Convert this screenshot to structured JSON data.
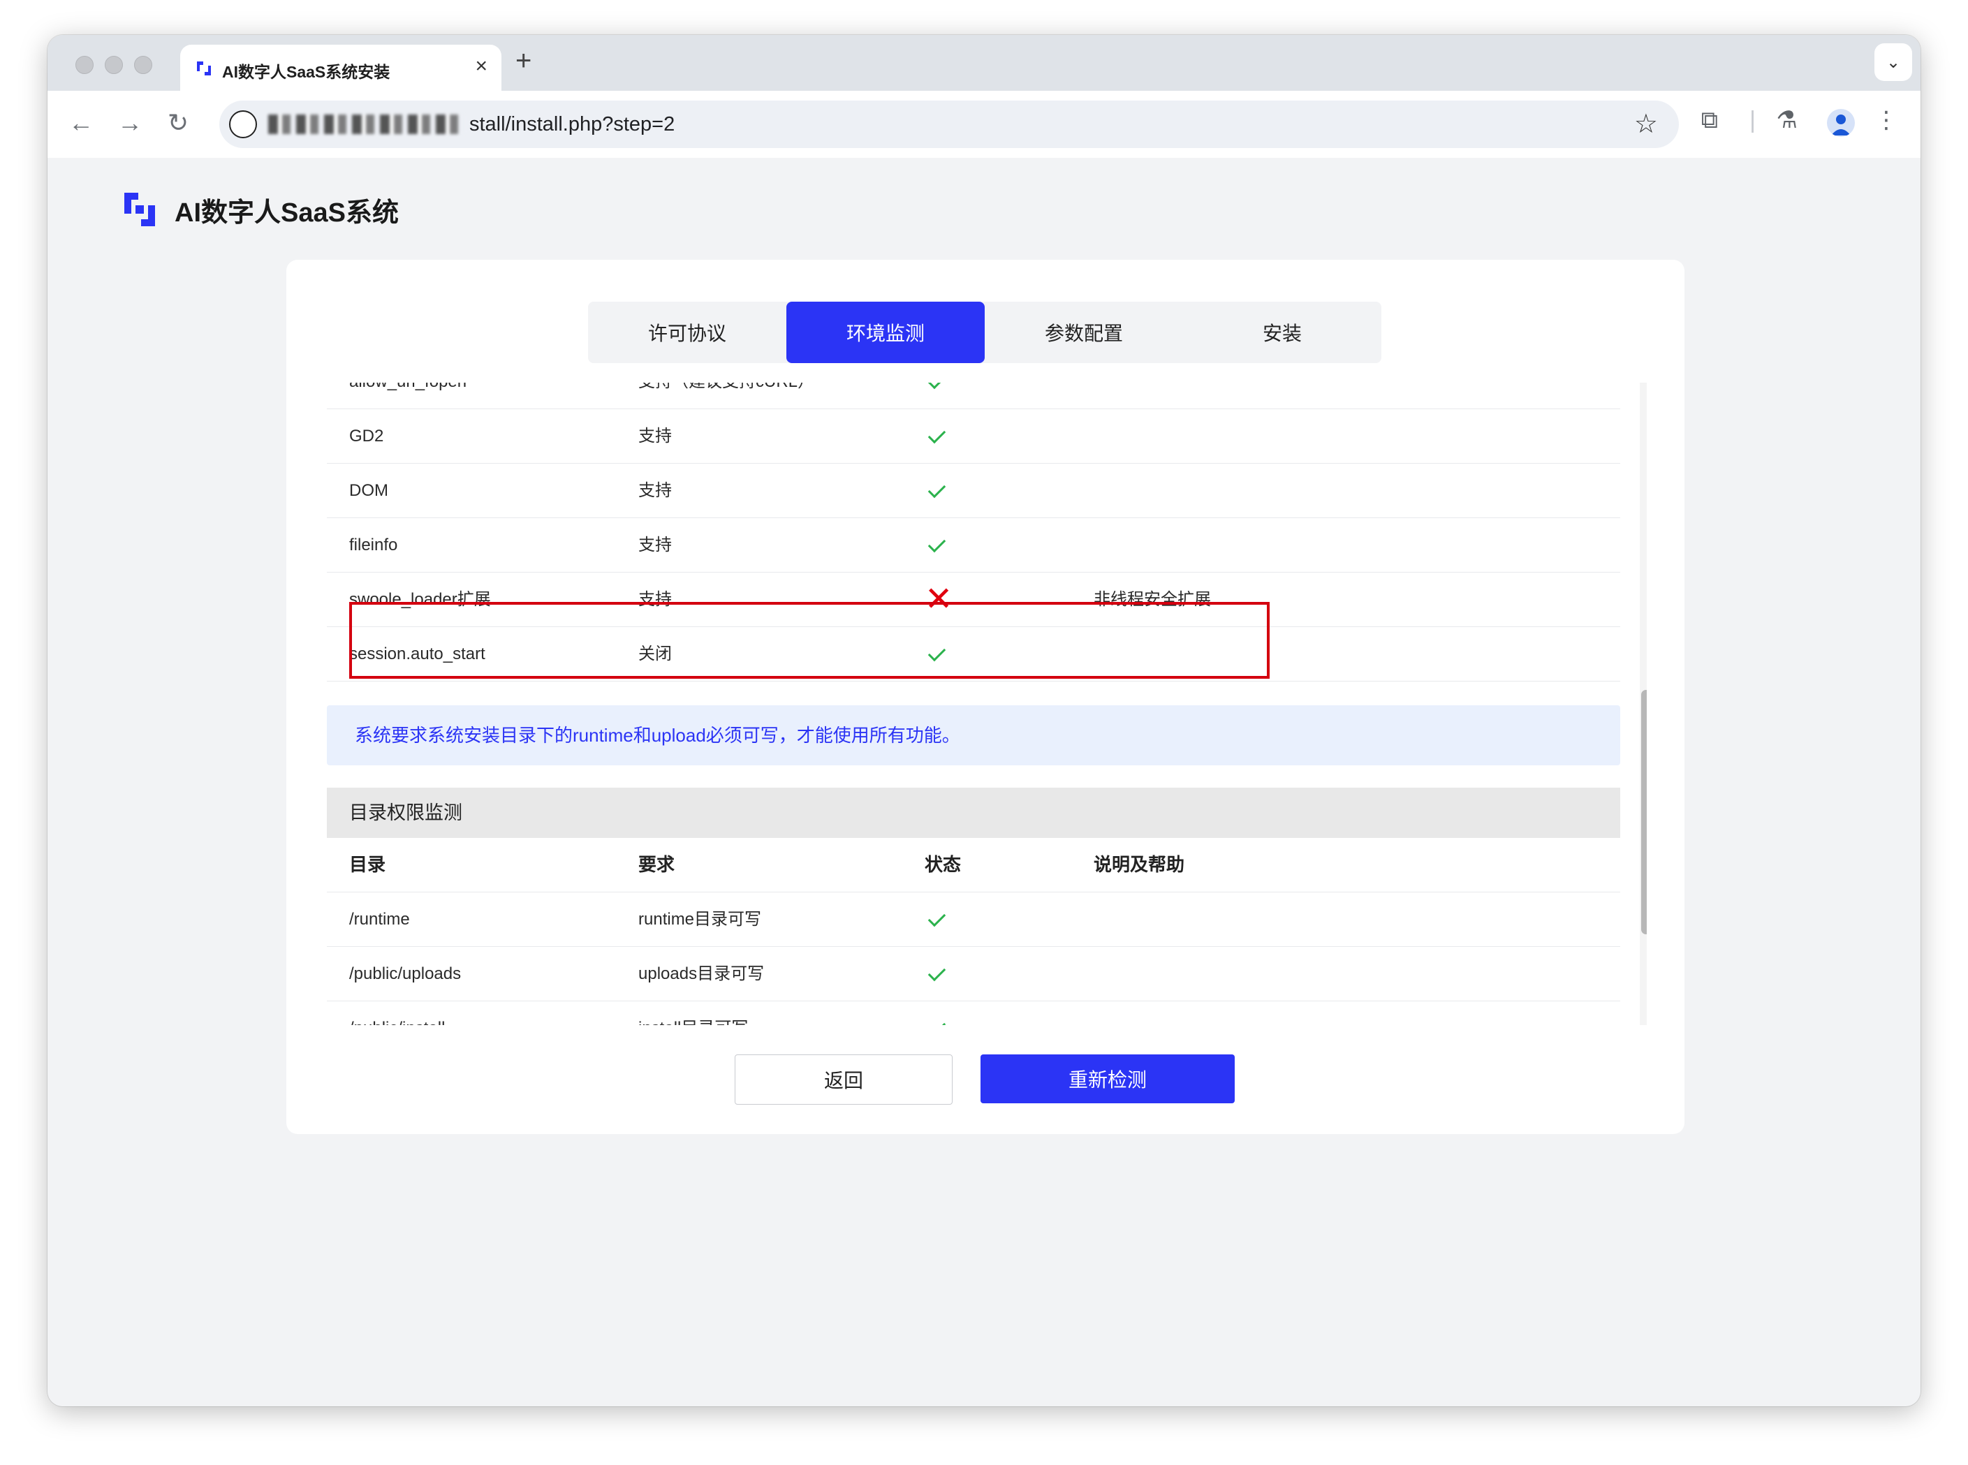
{
  "browser": {
    "tab_title": "AI数字人SaaS系统安装",
    "tab_close": "×",
    "new_tab": "+",
    "url_visible": "stall/install.php?step=2"
  },
  "brand": {
    "name": "AI数字人SaaS系统",
    "accent_color": "#2b34f5"
  },
  "steps": [
    {
      "label": "许可协议",
      "active": false
    },
    {
      "label": "环境监测",
      "active": true
    },
    {
      "label": "参数配置",
      "active": false
    },
    {
      "label": "安装",
      "active": false
    }
  ],
  "env_rows": [
    {
      "name": "allow_url_fopen",
      "requirement": "支持（建议支持cURL）",
      "status": "ok",
      "note": ""
    },
    {
      "name": "GD2",
      "requirement": "支持",
      "status": "ok",
      "note": ""
    },
    {
      "name": "DOM",
      "requirement": "支持",
      "status": "ok",
      "note": ""
    },
    {
      "name": "fileinfo",
      "requirement": "支持",
      "status": "ok",
      "note": ""
    },
    {
      "name": "swoole_loader扩展",
      "requirement": "支持",
      "status": "fail",
      "note": "非线程安全扩展"
    },
    {
      "name": "session.auto_start",
      "requirement": "关闭",
      "status": "ok",
      "note": ""
    }
  ],
  "notice": "系统要求系统安装目录下的runtime和upload必须可写，才能使用所有功能。",
  "dir_section": {
    "title": "目录权限监测",
    "headers": [
      "目录",
      "要求",
      "状态",
      "说明及帮助"
    ],
    "rows": [
      {
        "dir": "/runtime",
        "requirement": "runtime目录可写",
        "status": "ok"
      },
      {
        "dir": "/public/uploads",
        "requirement": "uploads目录可写",
        "status": "ok"
      },
      {
        "dir": "/public/install",
        "requirement": "install目录可写",
        "status": "ok"
      }
    ]
  },
  "status_icons": {
    "ok": "check-icon",
    "fail": "cross-icon"
  },
  "status_colors": {
    "ok": "#2bb24c",
    "fail": "#e0000f"
  },
  "highlight_color": "#d4000f",
  "buttons": {
    "back": "返回",
    "recheck": "重新检测"
  }
}
